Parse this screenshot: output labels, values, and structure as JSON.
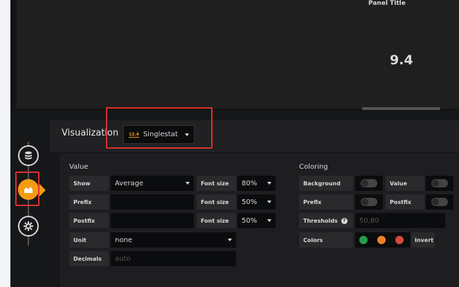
{
  "panel": {
    "title": "Panel Title",
    "value": "9.4"
  },
  "visualization": {
    "label": "Visualization",
    "badge": "12.4",
    "selected": "Singlestat"
  },
  "rail": {
    "icons": [
      "database-icon",
      "chart-area-icon",
      "settings-gear-icon"
    ],
    "active": "chart-area-icon"
  },
  "value_group": {
    "title": "Value",
    "show": {
      "label": "Show",
      "value": "Average"
    },
    "show_font": {
      "label": "Font size",
      "value": "80%"
    },
    "prefix": {
      "label": "Prefix",
      "value": ""
    },
    "prefix_font": {
      "label": "Font size",
      "value": "50%"
    },
    "postfix": {
      "label": "Postfix",
      "value": ""
    },
    "postfix_font": {
      "label": "Font size",
      "value": "50%"
    },
    "unit": {
      "label": "Unit",
      "value": "none"
    },
    "decimals": {
      "label": "Decimals",
      "placeholder": "auto"
    }
  },
  "coloring_group": {
    "title": "Coloring",
    "background": {
      "label": "Background",
      "enabled": false
    },
    "value": {
      "label": "Value",
      "enabled": false
    },
    "prefix": {
      "label": "Prefix",
      "enabled": false
    },
    "postfix": {
      "label": "Postfix",
      "enabled": false
    },
    "thresholds": {
      "label": "Thresholds",
      "placeholder": "50,80"
    },
    "colors": {
      "label": "Colors",
      "swatches": [
        "#299c46",
        "#ed8128",
        "#d44a3a"
      ],
      "invert_label": "Invert"
    }
  },
  "highlight_color": "#e02f2f"
}
